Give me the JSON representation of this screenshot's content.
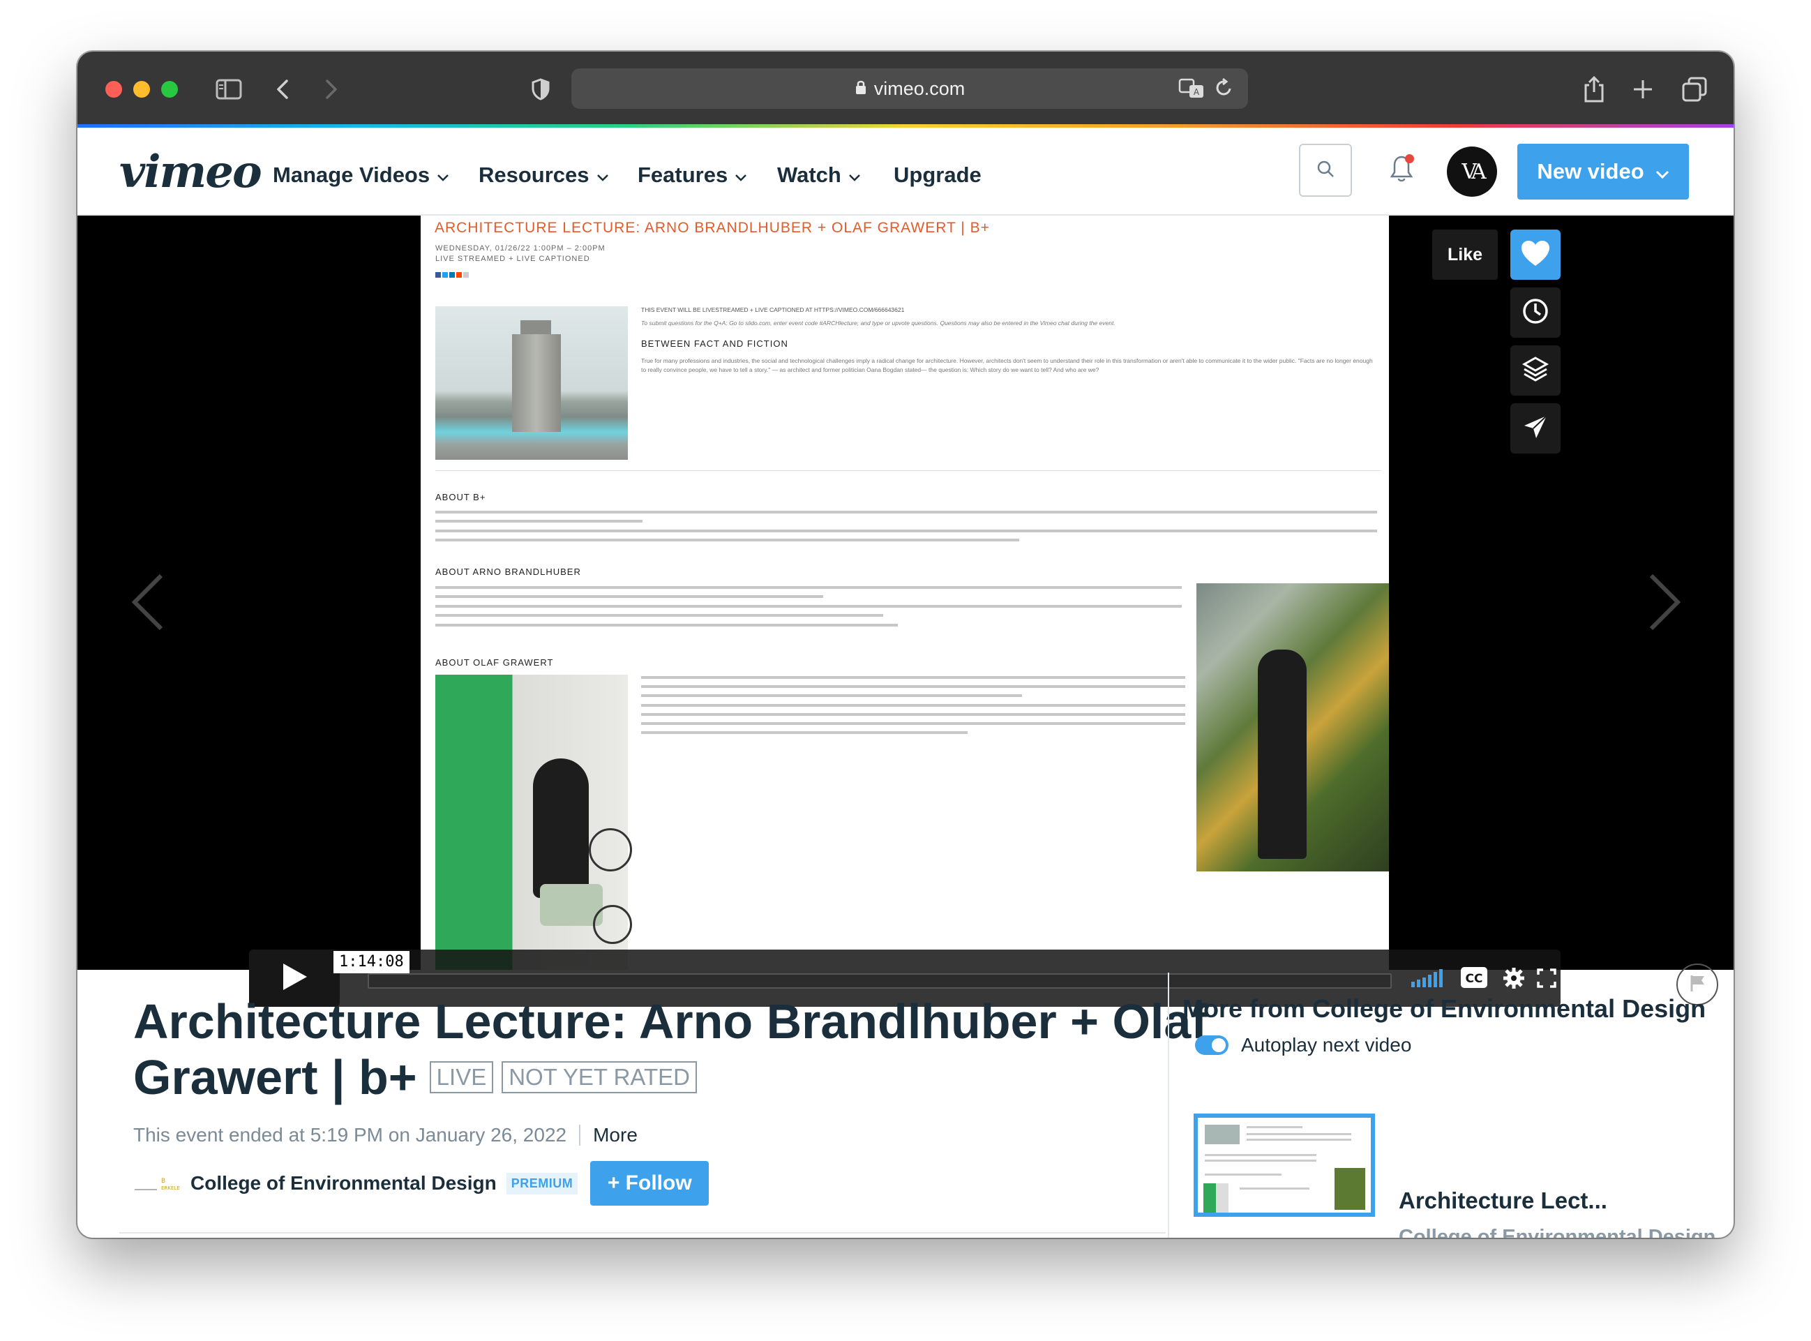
{
  "browser": {
    "url": "vimeo.com"
  },
  "nav": {
    "logo": "vimeo",
    "items": [
      {
        "label": "Manage Videos",
        "has_dropdown": true
      },
      {
        "label": "Resources",
        "has_dropdown": true
      },
      {
        "label": "Features",
        "has_dropdown": true
      },
      {
        "label": "Watch",
        "has_dropdown": true
      },
      {
        "label": "Upgrade",
        "has_dropdown": false
      }
    ],
    "new_video_label": "New video",
    "avatar_text": "VA",
    "accent_color": "#3ea1eb"
  },
  "player": {
    "like_tooltip": "Like",
    "timecode": "1:14:08",
    "side_buttons": [
      "heart-icon",
      "clock-icon",
      "layers-icon",
      "send-icon"
    ],
    "slide": {
      "title": "ARCHITECTURE LECTURE: ARNO BRANDLHUBER + OLAF GRAWERT | B+",
      "date": "WEDNESDAY, 01/26/22 1:00PM – 2:00PM",
      "stream": "LIVE STREAMED + LIVE CAPTIONED",
      "livestream_note": "THIS EVENT WILL BE LIVESTREAMED + LIVE CAPTIONED AT HTTPS://VIMEO.COM/666643621",
      "questions_note": "To submit questions for the Q+A: Go to slido.com, enter event code #ARCHlecture, and type or upvote questions. Questions may also be entered in the Vimeo chat during the event.",
      "h_fact_fiction": "BETWEEN FACT AND FICTION",
      "p_fact_fiction": "True for many professions and industries, the social and technological challenges imply a radical change for architecture. However, architects don't seem to understand their role in this transformation or aren't able to communicate it to the wider public. \"Facts are no longer enough to really convince people, we have to tell a story.\" — as architect and former politician Oana Bogdan stated— the question is: Which story do we want to tell? And who are we?",
      "h_about_b": "ABOUT B+",
      "h_about_arno": "ABOUT ARNO BRANDLHUBER",
      "h_about_olaf": "ABOUT OLAF GRAWERT"
    }
  },
  "video": {
    "title": "Architecture Lecture: Arno Brandlhuber + Olaf Grawert | b+",
    "badge_live": "LIVE",
    "badge_rating": "NOT YET RATED",
    "ended_text": "This event ended at 5:19 PM on January 26, 2022",
    "more_label": "More",
    "channel_name": "College of Environmental Design",
    "premium_label": "PREMIUM",
    "follow_label": "+ Follow"
  },
  "sidebar": {
    "heading": "More from College of Environmental Design",
    "autoplay_label": "Autoplay next video",
    "autoplay_on": true,
    "related": [
      {
        "title": "Architecture Lect...",
        "channel": "College of Environmental Design"
      }
    ]
  }
}
